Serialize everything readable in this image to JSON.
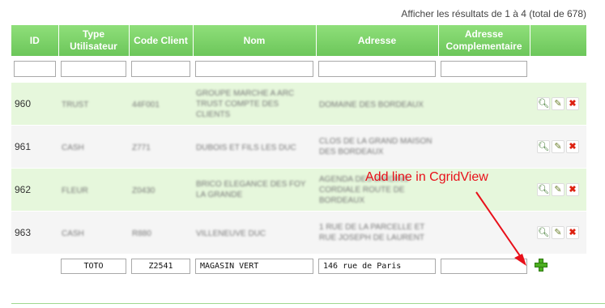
{
  "summary": "Afficher les résultats de 1 à 4 (total de 678)",
  "columns": [
    "ID",
    "Type Utilisateur",
    "Code Client",
    "Nom",
    "Adresse",
    "Adresse Complementaire"
  ],
  "rows": [
    {
      "id": "960",
      "type": "TRUST",
      "code": "44F001",
      "nom": "GROUPE MARCHE A ARC TRUST COMPTE DES CLIENTS",
      "adresse": "DOMAINE DES BORDEAUX",
      "adresse_comp": ""
    },
    {
      "id": "961",
      "type": "CASH",
      "code": "Z771",
      "nom": "DUBOIS ET FILS LES DUC",
      "adresse": "CLOS DE LA GRAND MAISON DES BORDEAUX",
      "adresse_comp": ""
    },
    {
      "id": "962",
      "type": "FLEUR",
      "code": "Z0430",
      "nom": "BRICO ELEGANCE DES FOY LA GRANDE",
      "adresse": "AGENDA DES JARDINS CORDIALE ROUTE DE BORDEAUX",
      "adresse_comp": ""
    },
    {
      "id": "963",
      "type": "CASH",
      "code": "R880",
      "nom": "VILLENEUVE DUC",
      "adresse": "1 RUE DE LA PARCELLE ET RUE JOSEPH DE LAURENT",
      "adresse_comp": ""
    }
  ],
  "new_row": {
    "type": "TOTO",
    "code": "Z2541",
    "nom": "MAGASIN VERT",
    "adresse": "146 rue de Paris",
    "adresse_comp": ""
  },
  "annotation": "Add line in CgridView",
  "icons": {
    "view": "magnifier-icon",
    "edit": "pencil-icon",
    "delete": "delete-icon",
    "add": "plus-icon"
  },
  "colors": {
    "header": "#7dd36b",
    "odd_row": "#e6f7dc",
    "even_row": "#f5f5f5",
    "annotation": "#e8101a",
    "add": "#4caf20"
  }
}
